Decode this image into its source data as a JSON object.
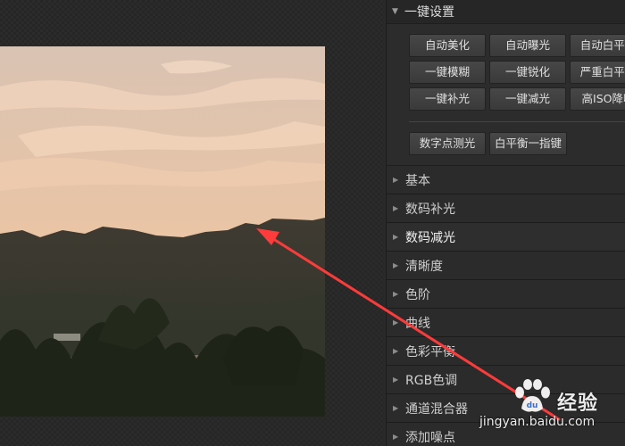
{
  "quick_settings": {
    "title": "一键设置",
    "buttons": [
      "自动美化",
      "自动曝光",
      "自动白平衡",
      "一键模糊",
      "一键锐化",
      "严重白平衡",
      "一键补光",
      "一键减光",
      "高ISO降噪"
    ],
    "extra_buttons": [
      "数字点测光",
      "白平衡一指键"
    ]
  },
  "menu": {
    "items": [
      "基本",
      "数码补光",
      "数码减光",
      "清晰度",
      "色阶",
      "曲线",
      "色彩平衡",
      "RGB色调",
      "通道混合器",
      "添加噪点"
    ],
    "active_index": 2
  },
  "watermark": {
    "title": "经验",
    "url": "jingyan.baidu.com"
  },
  "colors": {
    "arrow": "#ff3b3b",
    "panel_bg": "#262626",
    "button_bg": "#434343"
  }
}
